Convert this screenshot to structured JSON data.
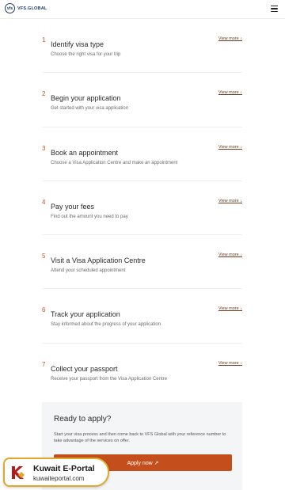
{
  "header": {
    "logo_text": "VFS.GLOBAL",
    "logo_mark": "vfs"
  },
  "steps": [
    {
      "number": "1",
      "title": "Identify visa type",
      "description": "Choose the right visa for your trip",
      "link": "View more ↓"
    },
    {
      "number": "2",
      "title": "Begin your application",
      "description": "Get started with your visa application",
      "link": "View more ↓"
    },
    {
      "number": "3",
      "title": "Book an appointment",
      "description": "Choose a Visa Application Centre and make an appointment",
      "link": "View more ↓"
    },
    {
      "number": "4",
      "title": "Pay your fees",
      "description": "Find out the amount you need to pay",
      "link": "View more ↓"
    },
    {
      "number": "5",
      "title": "Visit a Visa Application Centre",
      "description": "Attend your scheduled appointment",
      "link": "View more ↓"
    },
    {
      "number": "6",
      "title": "Track your application",
      "description": "Stay informed about the progress of your application",
      "link": "View more ↓"
    },
    {
      "number": "7",
      "title": "Collect your passport",
      "description": "Receive your passport from the Visa Application Centre",
      "link": "View more ↓"
    }
  ],
  "cta": {
    "title": "Ready to apply?",
    "text": "Start your visa process and then come back to VFS Global with your reference number to take advantage of the services on offer.",
    "button": "Apply now ↗"
  },
  "watermark": {
    "name": "Kuwait E-Portal",
    "url": "kuwaiteportal.com"
  },
  "colors": {
    "accent": "#c44f1c",
    "brand": "#1f3a64",
    "badge_border": "#e0a82e"
  }
}
